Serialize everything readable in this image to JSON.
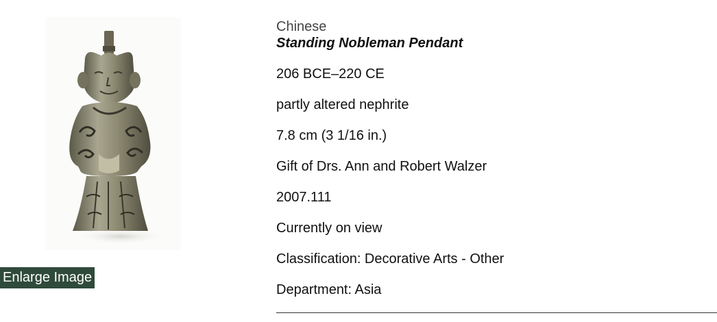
{
  "artwork": {
    "culture": "Chinese",
    "title": "Standing Nobleman Pendant",
    "date": "206 BCE–220 CE",
    "medium": "partly altered nephrite",
    "dimensions": "7.8 cm (3 1/16 in.)",
    "credit_line": "Gift of Drs. Ann and Robert Walzer",
    "accession_number": "2007.111",
    "view_status": "Currently on view",
    "classification": "Classification: Decorative Arts - Other",
    "department": "Department: Asia"
  },
  "image": {
    "subject": "jade-nobleman-pendant"
  },
  "actions": {
    "enlarge_label": "Enlarge Image"
  },
  "share": {
    "icons": [
      "share-icon",
      "facebook-icon",
      "twitter-icon",
      "tumblr-icon",
      "pinterest-icon"
    ],
    "colors": {
      "share": "#19a14b",
      "facebook": "#3b5a9a",
      "twitter": "#2d9fd9",
      "tumblr": "#2e4d6a",
      "pinterest": "#c8232c"
    }
  },
  "colors": {
    "enlarge_bg": "#2f4a3b"
  }
}
